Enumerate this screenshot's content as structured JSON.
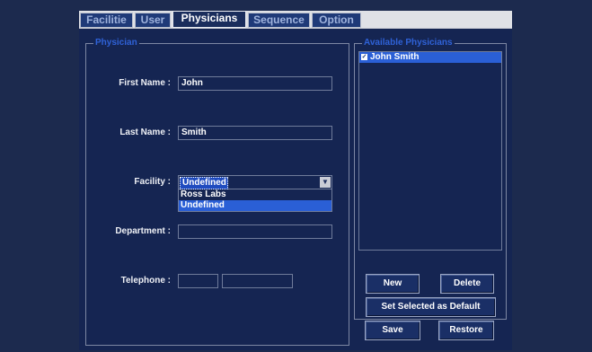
{
  "tabs": [
    {
      "label": "Facilitie",
      "active": false
    },
    {
      "label": "User",
      "active": false
    },
    {
      "label": "Physicians",
      "active": true
    },
    {
      "label": "Sequence",
      "active": false
    },
    {
      "label": "Option",
      "active": false
    }
  ],
  "physician_group": {
    "legend": "Physician",
    "first_name_label": "First Name :",
    "first_name_value": "John",
    "last_name_label": "Last Name :",
    "last_name_value": "Smith",
    "facility_label": "Facility :",
    "facility_value": "Undefined",
    "facility_options": [
      "Ross Labs",
      "Undefined"
    ],
    "department_label": "Department :",
    "department_value": "",
    "telephone_label": "Telephone :",
    "telephone_part1": "",
    "telephone_part2": ""
  },
  "available_group": {
    "legend": "Available Physicians",
    "items": [
      {
        "label": "John Smith",
        "checked": true,
        "selected": true
      }
    ]
  },
  "buttons": {
    "new": "New",
    "delete": "Delete",
    "set_default": "Set Selected as Default",
    "save": "Save",
    "restore": "Restore"
  },
  "colors": {
    "background": "#1c2a4e",
    "panel": "#152552",
    "selection": "#2a5fd6",
    "legend": "#2f62d8"
  }
}
